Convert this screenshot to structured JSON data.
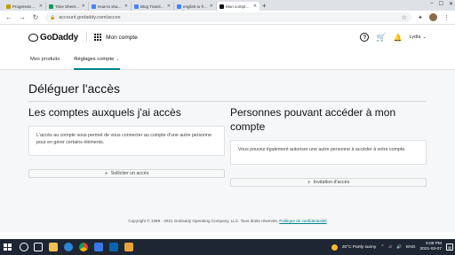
{
  "browser": {
    "tabs": [
      {
        "label": "Progressive Web",
        "color": "#c79a00",
        "active": false
      },
      {
        "label": "Time Sheet - Googl",
        "color": "#0f9d58",
        "active": false
      },
      {
        "label": "How to share acco",
        "color": "#4285f4",
        "active": false
      },
      {
        "label": "Blog Translation to",
        "color": "#4285f4",
        "active": false
      },
      {
        "label": "english to french tr",
        "color": "#4285f4",
        "active": false
      },
      {
        "label": "Mon compte | Accu",
        "color": "#111111",
        "active": true
      }
    ],
    "new_tab": "+",
    "url": "account.godaddy.com/acces",
    "controls": {
      "minimize": "–",
      "maximize": "☐",
      "close": "✕"
    }
  },
  "header": {
    "logo": "GoDaddy",
    "title": "Mon compte",
    "user": "Lydia"
  },
  "subnav": {
    "items": [
      {
        "label": "Mes produits"
      },
      {
        "label": "Réglages compte"
      }
    ]
  },
  "main": {
    "page_title": "Déléguer l'accès",
    "left": {
      "title": "Les comptes auxquels j'ai accès",
      "description": "L'accès au compte vous permet de vous connecter au compte d'une autre personne pour en gérer certains éléments.",
      "button": "Solliciter un accès"
    },
    "right": {
      "title": "Personnes pouvant accéder à mon compte",
      "description": "Vous pouvez également autoriser une autre personne à accéder à votre compte.",
      "button": "Invitation d'accès"
    },
    "footer": {
      "copyright": "Copyright © 1999 - 2021 GoDaddy Operating Company, LLC. Tous droits réservés.",
      "privacy_link": "Politique de confidentialité"
    }
  },
  "taskbar": {
    "weather": "20°C  Partly sunny",
    "language": "ENG",
    "time": "5:08 PM",
    "date": "2021-03-07"
  },
  "colors": {
    "accent": "#00838c",
    "page_bg": "#f5f7f8",
    "taskbar": "#1f2633"
  }
}
